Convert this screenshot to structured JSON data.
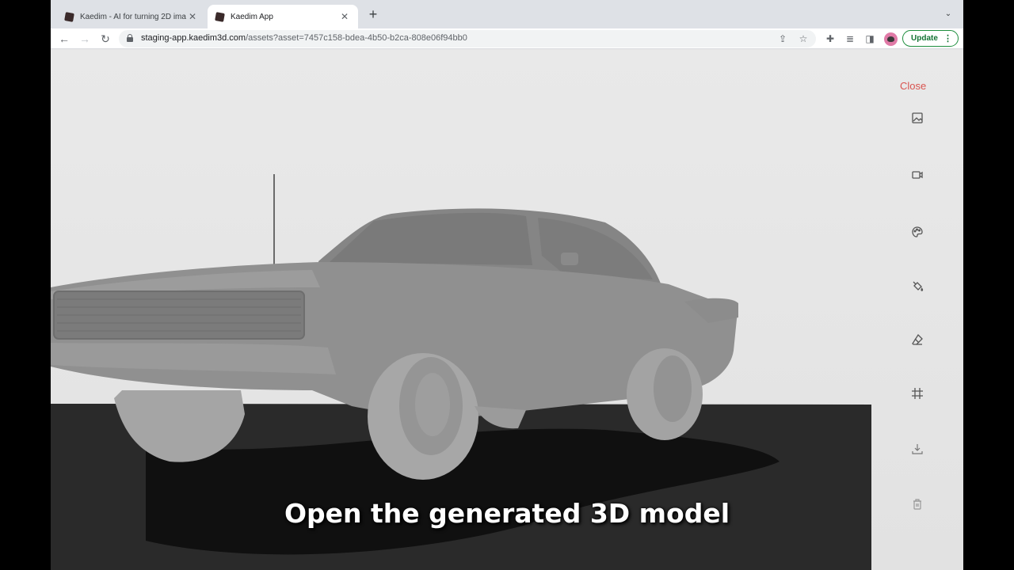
{
  "tabs": [
    {
      "title": "Kaedim - AI for turning 2D ima",
      "state": "inactive"
    },
    {
      "title": "Kaedim App",
      "state": "active"
    }
  ],
  "toolbar": {
    "url_host": "staging-app.kaedim3d.com",
    "url_path": "/assets?asset=7457c158-bdea-4b50-b2ca-808e06f94bb0",
    "update_label": "Update"
  },
  "viewer": {
    "close_label": "Close",
    "tools": [
      "image-icon",
      "video-icon",
      "palette-icon",
      "paint-bucket-icon",
      "eraser-icon",
      "grid-icon",
      "download-icon",
      "delete-icon"
    ]
  },
  "caption": "Open the generated 3D model",
  "colors": {
    "close": "#d9534f",
    "update": "#137333",
    "floor": "#2a2a2a",
    "model": "#8f8f8f",
    "background": "#e6e6e6"
  }
}
